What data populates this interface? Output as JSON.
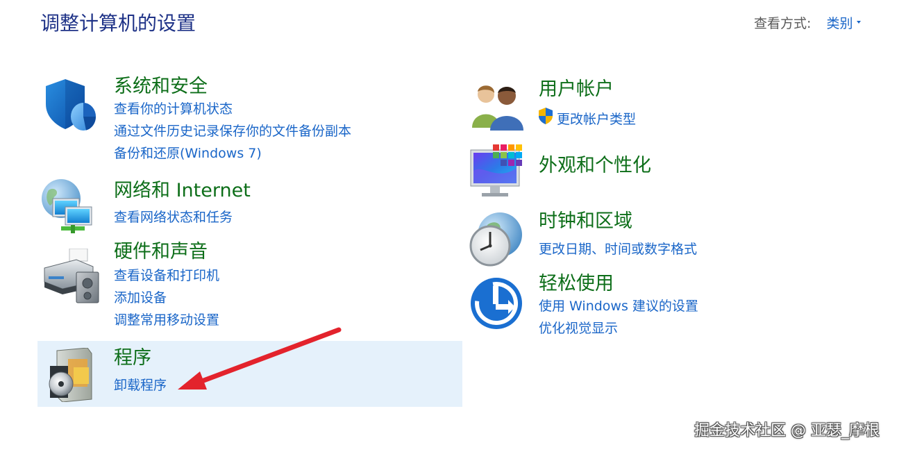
{
  "header": {
    "title": "调整计算机的设置",
    "view_by_label": "查看方式:",
    "view_by_value": "类别"
  },
  "left": [
    {
      "title": "系统和安全",
      "icon": "security-shield-icon",
      "links": [
        "查看你的计算机状态",
        "通过文件历史记录保存你的文件备份副本",
        "备份和还原(Windows 7)"
      ]
    },
    {
      "title": "网络和 Internet",
      "icon": "network-globe-icon",
      "links": [
        "查看网络状态和任务"
      ]
    },
    {
      "title": "硬件和声音",
      "icon": "printer-speaker-icon",
      "links": [
        "查看设备和打印机",
        "添加设备",
        "调整常用移动设置"
      ]
    },
    {
      "title": "程序",
      "icon": "programs-disc-icon",
      "links": [
        "卸载程序"
      ],
      "selected": true
    }
  ],
  "right": [
    {
      "title": "用户帐户",
      "icon": "users-icon",
      "links": [
        "更改帐户类型"
      ]
    },
    {
      "title": "外观和个性化",
      "icon": "monitor-colors-icon",
      "links": []
    },
    {
      "title": "时钟和区域",
      "icon": "clock-globe-icon",
      "links": [
        "更改日期、时间或数字格式"
      ]
    },
    {
      "title": "轻松使用",
      "icon": "ease-of-access-icon",
      "links": [
        "使用 Windows 建议的设置",
        "优化视觉显示"
      ]
    }
  ],
  "watermark": "掘金技术社区 @ 亚瑟_摩根",
  "colors": {
    "title": "#1e3287",
    "category": "#0d6e19",
    "link": "#1a66c8",
    "selected_bg": "#e5f1fb",
    "annotation_arrow": "#e3232c"
  }
}
